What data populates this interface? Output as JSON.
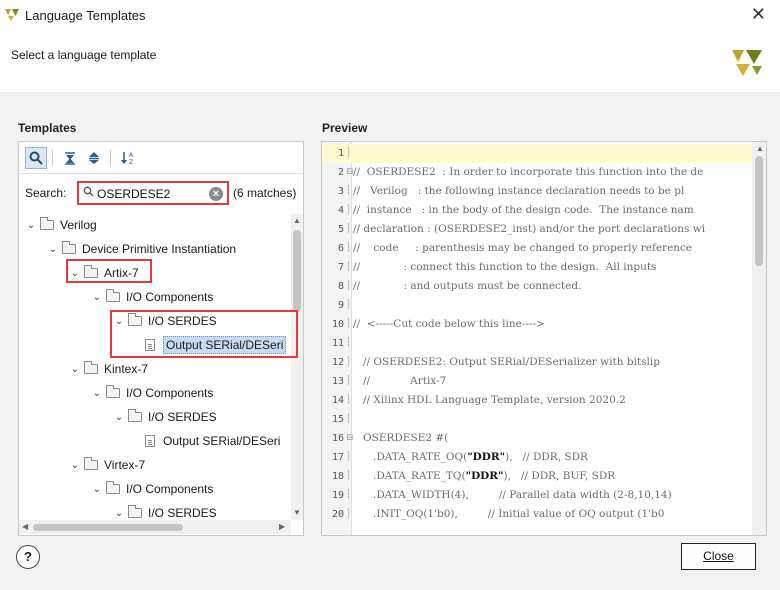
{
  "window": {
    "title": "Language Templates",
    "close_glyph": "✕"
  },
  "subtitle": "Select a language template",
  "templates": {
    "section_label": "Templates",
    "toolbar": [
      {
        "icon": "search-icon",
        "glyph": "🔍"
      },
      {
        "icon": "collapse-all-icon",
        "glyph": "⇱"
      },
      {
        "icon": "expand-all-icon",
        "glyph": "⇕"
      },
      {
        "icon": "sort-icon",
        "glyph": "↓A"
      }
    ],
    "search": {
      "label": "Search:",
      "value": "OSERDESE2",
      "match_count": "(6 matches)"
    },
    "tree": [
      {
        "label": "Verilog",
        "depth": 0,
        "type": "folder",
        "expanded": true
      },
      {
        "label": "Device Primitive Instantiation",
        "depth": 1,
        "type": "folder",
        "expanded": true
      },
      {
        "label": "Artix-7",
        "depth": 2,
        "type": "folder",
        "expanded": true
      },
      {
        "label": "I/O Components",
        "depth": 3,
        "type": "folder",
        "expanded": true
      },
      {
        "label": "I/O SERDES",
        "depth": 4,
        "type": "folder",
        "expanded": true
      },
      {
        "label": "Output SERial/DESeri",
        "depth": 5,
        "type": "file",
        "selected": true
      },
      {
        "label": "Kintex-7",
        "depth": 2,
        "type": "folder",
        "expanded": true
      },
      {
        "label": "I/O Components",
        "depth": 3,
        "type": "folder",
        "expanded": true
      },
      {
        "label": "I/O SERDES",
        "depth": 4,
        "type": "folder",
        "expanded": true
      },
      {
        "label": "Output SERial/DESeri",
        "depth": 5,
        "type": "file"
      },
      {
        "label": "Virtex-7",
        "depth": 2,
        "type": "folder",
        "expanded": true
      },
      {
        "label": "I/O Components",
        "depth": 3,
        "type": "folder",
        "expanded": true
      },
      {
        "label": "I/O SERDES",
        "depth": 4,
        "type": "folder",
        "expanded": true
      }
    ]
  },
  "preview": {
    "section_label": "Preview",
    "lines": [
      {
        "n": "1",
        "text": ""
      },
      {
        "n": "2",
        "text": "//  OSERDESE2  : In order to incorporate this function into the de"
      },
      {
        "n": "3",
        "text": "//   Verilog   : the following instance declaration needs to be pl"
      },
      {
        "n": "4",
        "text": "//  instance   : in the body of the design code.  The instance nam"
      },
      {
        "n": "5",
        "text": "// declaration : (OSERDESE2_inst) and/or the port declarations wi"
      },
      {
        "n": "6",
        "text": "//    code     : parenthesis may be changed to properly reference"
      },
      {
        "n": "7",
        "text": "//             : connect this function to the design.  All inputs"
      },
      {
        "n": "8",
        "text": "//             : and outputs must be connected."
      },
      {
        "n": "9",
        "text": ""
      },
      {
        "n": "10",
        "text": "//  <-----Cut code below this line---->"
      },
      {
        "n": "11",
        "text": ""
      },
      {
        "n": "12",
        "text": "   // OSERDESE2: Output SERial/DESerializer with bitslip"
      },
      {
        "n": "13",
        "text": "   //            Artix-7"
      },
      {
        "n": "14",
        "text": "   // Xilinx HDL Language Template, version 2020.2"
      },
      {
        "n": "15",
        "text": ""
      },
      {
        "n": "16",
        "text": "   OSERDESE2 #("
      },
      {
        "n": "17",
        "text": "      .DATA_RATE_OQ(\"DDR\"),   // DDR, SDR"
      },
      {
        "n": "18",
        "text": "      .DATA_RATE_TQ(\"DDR\"),   // DDR, BUF, SDR"
      },
      {
        "n": "19",
        "text": "      .DATA_WIDTH(4),         // Parallel data width (2-8,10,14)"
      },
      {
        "n": "20",
        "text": "      .INIT_OQ(1'b0),         // Initial value of OQ output (1'b0"
      }
    ]
  },
  "buttons": {
    "help": "?",
    "close": "Close"
  }
}
